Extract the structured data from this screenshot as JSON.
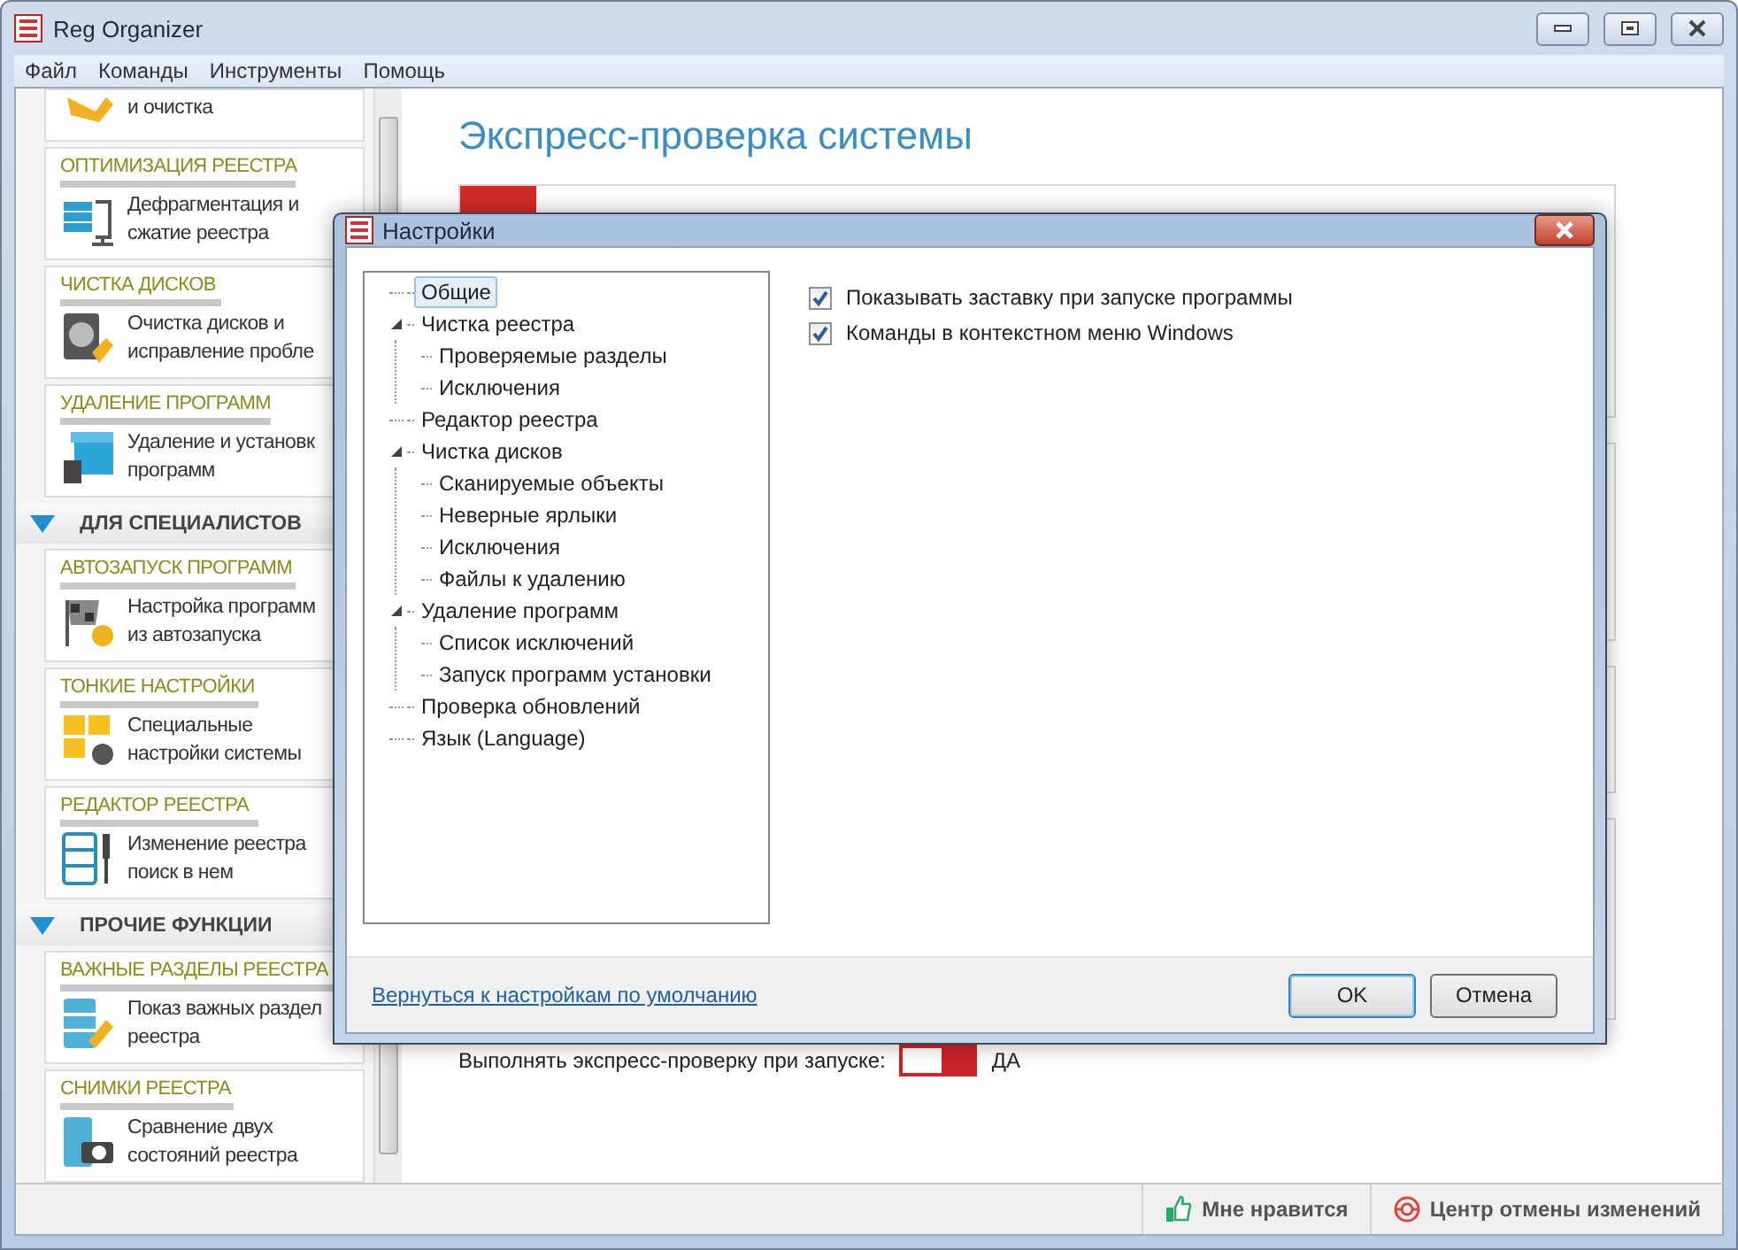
{
  "window": {
    "title": "Reg Organizer"
  },
  "menu": [
    "Файл",
    "Команды",
    "Инструменты",
    "Помощь"
  ],
  "sidebar": {
    "items": [
      {
        "kind": "tool",
        "lines": [
          "и очистка"
        ]
      },
      {
        "kind": "tool",
        "title": "ОПТИМИЗАЦИЯ РЕЕСТРА",
        "lines": [
          "Дефрагментация и",
          "сжатие реестра"
        ]
      },
      {
        "kind": "tool",
        "title": "ЧИСТКА ДИСКОВ",
        "lines": [
          "Очистка дисков и",
          "исправление пробле"
        ]
      },
      {
        "kind": "tool",
        "title": "УДАЛЕНИЕ ПРОГРАММ",
        "lines": [
          "Удаление и установк",
          "программ"
        ]
      },
      {
        "kind": "group",
        "label": "ДЛЯ СПЕЦИАЛИСТОВ",
        "expanded": true
      },
      {
        "kind": "tool",
        "title": "АВТОЗАПУСК ПРОГРАММ",
        "lines": [
          "Настройка программ",
          "из автозапуска"
        ]
      },
      {
        "kind": "tool",
        "title": "ТОНКИЕ НАСТРОЙКИ",
        "lines": [
          "Специальные",
          "настройки системы"
        ]
      },
      {
        "kind": "tool",
        "title": "РЕДАКТОР РЕЕСТРА",
        "lines": [
          "Изменение реестра",
          "поиск в нем"
        ]
      },
      {
        "kind": "group",
        "label": "ПРОЧИЕ ФУНКЦИИ",
        "expanded": true
      },
      {
        "kind": "tool",
        "title": "ВАЖНЫЕ РАЗДЕЛЫ РЕЕСТРА",
        "lines": [
          "Показ важных раздел",
          "реестра"
        ]
      },
      {
        "kind": "tool",
        "title": "СНИМКИ РЕЕСТРА",
        "lines": [
          "Сравнение двух",
          "состояний реестра"
        ]
      }
    ]
  },
  "main": {
    "heading": "Экспресс-проверка системы",
    "startup_check": {
      "label": "Выполнять экспресс-проверку при запуске:",
      "on": true,
      "value": "ДА"
    }
  },
  "dialog": {
    "title": "Настройки",
    "tree": [
      {
        "label": "Общие",
        "selected": true
      },
      {
        "label": "Чистка реестра",
        "selected": false,
        "expanded": true,
        "children": [
          {
            "label": "Проверяемые разделы",
            "selected": false
          },
          {
            "label": "Исключения",
            "selected": false
          }
        ]
      },
      {
        "label": "Редактор реестра",
        "selected": false
      },
      {
        "label": "Чистка дисков",
        "selected": false,
        "expanded": true,
        "children": [
          {
            "label": "Сканируемые объекты",
            "selected": false
          },
          {
            "label": "Неверные ярлыки",
            "selected": false
          },
          {
            "label": "Исключения",
            "selected": false
          },
          {
            "label": "Файлы к удалению",
            "selected": false
          }
        ]
      },
      {
        "label": "Удаление программ",
        "selected": false,
        "expanded": true,
        "children": [
          {
            "label": "Список исключений",
            "selected": false
          },
          {
            "label": "Запуск программ установки",
            "selected": false
          }
        ]
      },
      {
        "label": "Проверка обновлений",
        "selected": false
      },
      {
        "label": "Язык (Language)",
        "selected": false
      }
    ],
    "options": [
      {
        "label": "Показывать заставку при запуске программы",
        "checked": true
      },
      {
        "label": "Команды в контекстном меню Windows",
        "checked": true
      }
    ],
    "reset_link": "Вернуться к настройкам по умолчанию",
    "buttons": [
      {
        "label": "OK",
        "default": true
      },
      {
        "label": "Отмена",
        "default": false
      }
    ]
  },
  "status_bar": {
    "buttons": [
      {
        "kind": "like",
        "label": "Мне нравится"
      },
      {
        "kind": "undo",
        "label": "Центр отмены изменений"
      }
    ]
  }
}
